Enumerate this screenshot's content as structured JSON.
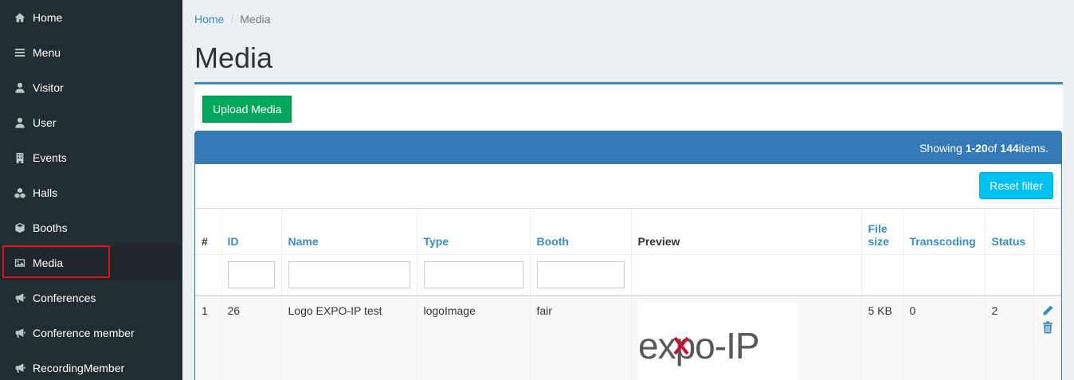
{
  "sidebar": {
    "items": [
      {
        "label": "Home",
        "icon": "home-icon"
      },
      {
        "label": "Menu",
        "icon": "bars-icon"
      },
      {
        "label": "Visitor",
        "icon": "user-icon"
      },
      {
        "label": "User",
        "icon": "user-icon"
      },
      {
        "label": "Events",
        "icon": "building-icon"
      },
      {
        "label": "Halls",
        "icon": "cubes-icon"
      },
      {
        "label": "Booths",
        "icon": "cube-icon"
      },
      {
        "label": "Media",
        "icon": "image-icon",
        "active": true
      },
      {
        "label": "Conferences",
        "icon": "bullhorn-icon"
      },
      {
        "label": "Conference member",
        "icon": "bullhorn-icon"
      },
      {
        "label": "RecordingMember",
        "icon": "bullhorn-icon"
      }
    ]
  },
  "breadcrumb": {
    "home": "Home",
    "separator": "/",
    "current": "Media"
  },
  "page": {
    "title": "Media",
    "upload_label": "Upload Media"
  },
  "summary": {
    "prefix": "Showing ",
    "range": "1-20",
    "of": " of ",
    "total": "144",
    "suffix": " items."
  },
  "toolbar": {
    "reset_label": "Reset filter"
  },
  "table": {
    "columns": {
      "num": "#",
      "id": "ID",
      "name": "Name",
      "type": "Type",
      "booth": "Booth",
      "preview": "Preview",
      "file_size_1": "File",
      "file_size_2": "size",
      "transcoding": "Transcoding",
      "status": "Status"
    },
    "rows": [
      {
        "num": "1",
        "id": "26",
        "name": "Logo EXPO-IP test",
        "type": "logoImage",
        "booth": "fair",
        "preview_text_a": "expo",
        "preview_text_b": "-IP",
        "file_size": "5 KB",
        "transcoding": "0",
        "status": "2"
      }
    ]
  },
  "colors": {
    "sidebar_bg": "#222d32",
    "accent": "#3c8dbc",
    "panel_header": "#337ab7",
    "success": "#00a65a",
    "info": "#00c0ef",
    "highlight": "#e0131c"
  }
}
